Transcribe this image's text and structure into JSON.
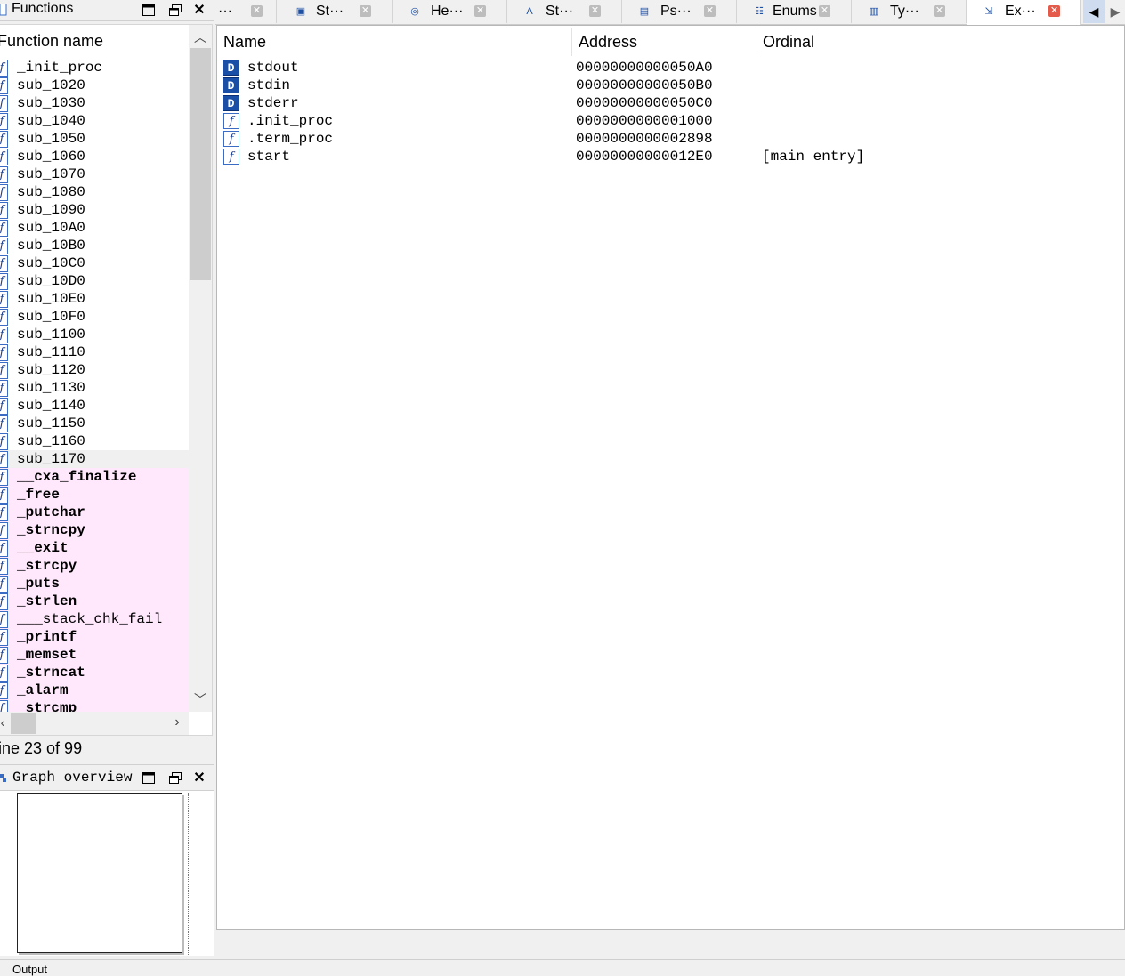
{
  "functions_panel": {
    "title": "Functions",
    "column_header": "Function name",
    "status": "ine 23 of 99",
    "items": [
      {
        "name": "_init_proc",
        "kind": "normal"
      },
      {
        "name": "sub_1020",
        "kind": "normal"
      },
      {
        "name": "sub_1030",
        "kind": "normal"
      },
      {
        "name": "sub_1040",
        "kind": "normal"
      },
      {
        "name": "sub_1050",
        "kind": "normal"
      },
      {
        "name": "sub_1060",
        "kind": "normal"
      },
      {
        "name": "sub_1070",
        "kind": "normal"
      },
      {
        "name": "sub_1080",
        "kind": "normal"
      },
      {
        "name": "sub_1090",
        "kind": "normal"
      },
      {
        "name": "sub_10A0",
        "kind": "normal"
      },
      {
        "name": "sub_10B0",
        "kind": "normal"
      },
      {
        "name": "sub_10C0",
        "kind": "normal"
      },
      {
        "name": "sub_10D0",
        "kind": "normal"
      },
      {
        "name": "sub_10E0",
        "kind": "normal"
      },
      {
        "name": "sub_10F0",
        "kind": "normal"
      },
      {
        "name": "sub_1100",
        "kind": "normal"
      },
      {
        "name": "sub_1110",
        "kind": "normal"
      },
      {
        "name": "sub_1120",
        "kind": "normal"
      },
      {
        "name": "sub_1130",
        "kind": "normal"
      },
      {
        "name": "sub_1140",
        "kind": "normal"
      },
      {
        "name": "sub_1150",
        "kind": "normal"
      },
      {
        "name": "sub_1160",
        "kind": "normal"
      },
      {
        "name": "sub_1170",
        "kind": "selected"
      },
      {
        "name": "__cxa_finalize",
        "kind": "library-bold"
      },
      {
        "name": "_free",
        "kind": "library-bold"
      },
      {
        "name": "_putchar",
        "kind": "library-bold"
      },
      {
        "name": "_strncpy",
        "kind": "library-bold"
      },
      {
        "name": "__exit",
        "kind": "library-bold"
      },
      {
        "name": "_strcpy",
        "kind": "library-bold"
      },
      {
        "name": "_puts",
        "kind": "library-bold"
      },
      {
        "name": "_strlen",
        "kind": "library-bold"
      },
      {
        "name": "___stack_chk_fail",
        "kind": "library"
      },
      {
        "name": "_printf",
        "kind": "library-bold"
      },
      {
        "name": "_memset",
        "kind": "library-bold"
      },
      {
        "name": "_strncat",
        "kind": "library-bold"
      },
      {
        "name": "_alarm",
        "kind": "library-bold"
      },
      {
        "name": "_strcmp",
        "kind": "library-bold"
      }
    ]
  },
  "graph_panel": {
    "title": "Graph overview"
  },
  "tabs": [
    {
      "label": "···",
      "icon": "tab-icon",
      "active": false
    },
    {
      "label": "St···",
      "icon": "structures-icon",
      "active": false
    },
    {
      "label": "He···",
      "icon": "hex-view-icon",
      "active": false
    },
    {
      "label": "St···",
      "icon": "strings-icon",
      "active": false
    },
    {
      "label": "Ps···",
      "icon": "pseudocode-icon",
      "active": false
    },
    {
      "label": "Enums",
      "icon": "enums-icon",
      "active": false
    },
    {
      "label": "Ty···",
      "icon": "types-icon",
      "active": false
    },
    {
      "label": "Ex···",
      "icon": "exports-icon",
      "active": true
    }
  ],
  "exports": {
    "columns": {
      "name": "Name",
      "address": "Address",
      "ordinal": "Ordinal"
    },
    "rows": [
      {
        "type": "data",
        "name": "stdout",
        "address": "00000000000050A0",
        "ordinal": ""
      },
      {
        "type": "data",
        "name": "stdin",
        "address": "00000000000050B0",
        "ordinal": ""
      },
      {
        "type": "data",
        "name": "stderr",
        "address": "00000000000050C0",
        "ordinal": ""
      },
      {
        "type": "func",
        "name": ".init_proc",
        "address": "0000000000001000",
        "ordinal": ""
      },
      {
        "type": "func",
        "name": ".term_proc",
        "address": "0000000000002898",
        "ordinal": ""
      },
      {
        "type": "func",
        "name": "start",
        "address": "00000000000012E0",
        "ordinal": "[main entry]"
      }
    ]
  },
  "icon_glyphs": {
    "data": "D",
    "func": "f"
  },
  "bottom": {
    "output_label": "Output"
  },
  "colors": {
    "library_bg": "#ffe8fc",
    "data_icon": "#1a4fa8",
    "active_close": "#e45b4b"
  }
}
